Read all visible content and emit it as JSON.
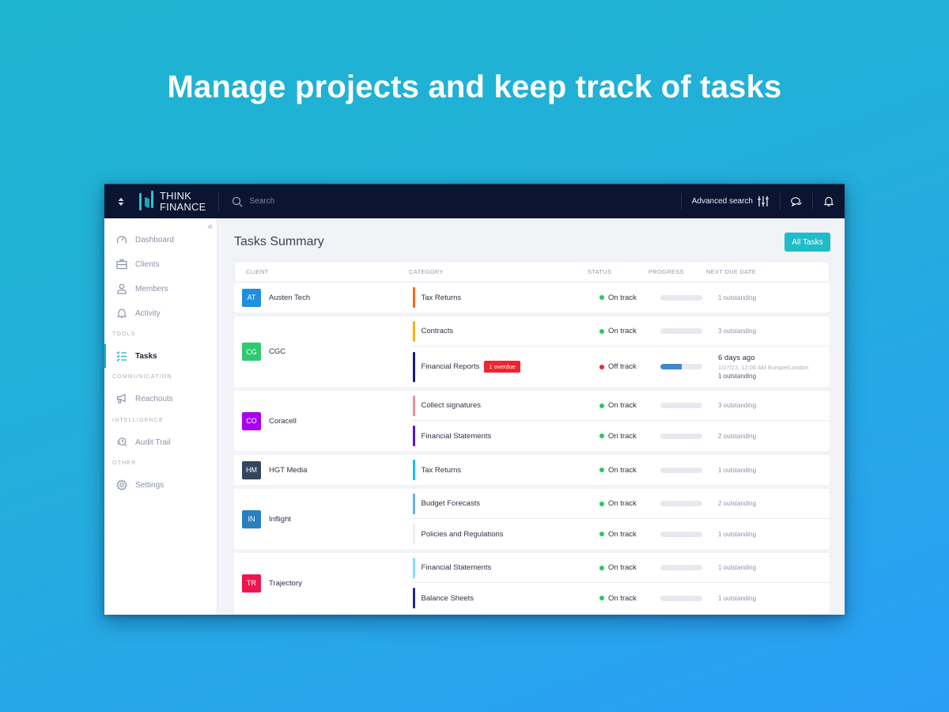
{
  "hero": {
    "title": "Manage projects and keep track of tasks"
  },
  "topbar": {
    "logo_line1": "THINK",
    "logo_line2": "FINANCE",
    "search_placeholder": "Search",
    "advanced_search": "Advanced search"
  },
  "sidebar": {
    "items": [
      {
        "label": "Dashboard",
        "icon": "gauge-icon"
      },
      {
        "label": "Clients",
        "icon": "briefcase-icon"
      },
      {
        "label": "Members",
        "icon": "user-icon"
      },
      {
        "label": "Activity",
        "icon": "bell-icon"
      }
    ],
    "sections": {
      "tools": "TOOLS",
      "communication": "COMMUNICATION",
      "intelligence": "INTELLIGENCE",
      "other": "OTHER"
    },
    "tasks": "Tasks",
    "reachouts": "Reachouts",
    "audit_trail": "Audit Trail",
    "settings": "Settings",
    "active": "Tasks"
  },
  "main": {
    "title": "Tasks Summary",
    "all_tasks_button": "All Tasks",
    "columns": [
      "CLIENT",
      "CATEGORY",
      "STATUS",
      "PROGRESS",
      "NEXT DUE DATE"
    ],
    "groups": [
      {
        "initials": "AT",
        "client": "Austen Tech",
        "color": "#1f8fe0",
        "tasks": [
          {
            "category": "Tax Returns",
            "bar_color": "#f5661a",
            "status": "On track",
            "progress": 0,
            "due": "1 outstanding"
          }
        ]
      },
      {
        "initials": "CG",
        "client": "CGC",
        "color": "#2ec971",
        "tasks": [
          {
            "category": "Contracts",
            "bar_color": "#f4b400",
            "status": "On track",
            "progress": 0,
            "due": "3 outstanding"
          },
          {
            "category": "Financial Reports",
            "bar_color": "#1a1a7a",
            "badge": "1 overdue",
            "status": "Off track",
            "progress": 0.5,
            "due_relative": "6 days ago",
            "due_absolute": "1/27/23, 12:00 AM Europe/London",
            "due": "1 outstanding"
          }
        ]
      },
      {
        "initials": "CO",
        "client": "Coracell",
        "color": "#a800f0",
        "tasks": [
          {
            "category": "Collect signatures",
            "bar_color": "#f08ea2",
            "status": "On track",
            "progress": 0,
            "due": "3 outstanding"
          },
          {
            "category": "Financial Statements",
            "bar_color": "#5a10d8",
            "status": "On track",
            "progress": 0,
            "due": "2 outstanding"
          }
        ]
      },
      {
        "initials": "HM",
        "client": "HGT Media",
        "color": "#33465e",
        "tasks": [
          {
            "category": "Tax Returns",
            "bar_color": "#14c0f0",
            "status": "On track",
            "progress": 0,
            "due": "1 outstanding"
          }
        ]
      },
      {
        "initials": "IN",
        "client": "Inflight",
        "color": "#2a7fc0",
        "tasks": [
          {
            "category": "Budget Forecasts",
            "bar_color": "#6aaee8",
            "status": "On track",
            "progress": 0,
            "due": "2 outstanding"
          },
          {
            "category": "Policies and Regulations",
            "bar_color": "#eceef3",
            "status": "On track",
            "progress": 0,
            "due": "1 outstanding"
          }
        ]
      },
      {
        "initials": "TR",
        "client": "Trajectory",
        "color": "#ee1650",
        "tasks": [
          {
            "category": "Financial Statements",
            "bar_color": "#86ddf5",
            "status": "On track",
            "progress": 0,
            "due": "1 outstanding"
          },
          {
            "category": "Balance Sheets",
            "bar_color": "#1f2a8a",
            "status": "On track",
            "progress": 0,
            "due": "1 outstanding"
          }
        ]
      }
    ]
  },
  "colors": {
    "on_track": "#2fc55a",
    "off_track": "#f0242f",
    "accent": "#1ebdc9",
    "topbar": "#0b1430"
  }
}
